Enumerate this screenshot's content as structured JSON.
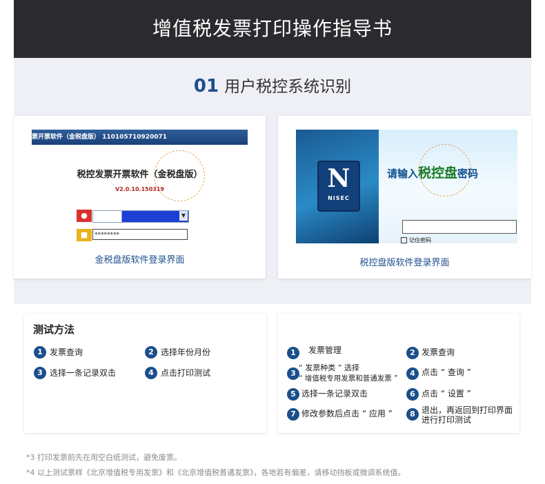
{
  "header": {
    "title": "增值税发票打印操作指导书"
  },
  "section": {
    "num": "01",
    "title": "用户税控系统识别"
  },
  "left_shot": {
    "window_title": "票开票软件（金税盘版） 110105710920071",
    "app_name": "税控发票开票软件（金税盘版）",
    "version": "V2.0.10.150319",
    "password_mask": "********",
    "caption": "金税盘版软件登录界面"
  },
  "right_shot": {
    "logo_text": "NISEC",
    "prompt_pre": "请输入",
    "prompt_big": "税控盘",
    "prompt_post": "密码",
    "remember": "记住密码",
    "caption": "税控盘版软件登录界面"
  },
  "test": {
    "title": "测试方法",
    "steps": [
      {
        "n": "1",
        "text": "发票查询"
      },
      {
        "n": "2",
        "text": "选择年份月份"
      },
      {
        "n": "3",
        "text": "选择一条记录双击"
      },
      {
        "n": "4",
        "text": "点击打印测试"
      }
    ]
  },
  "steps": [
    {
      "n": "1",
      "line1": "发票管理",
      "line2": ""
    },
    {
      "n": "2",
      "line1": "发票查询",
      "line2": ""
    },
    {
      "n": "3",
      "line1": "“ 发票种类 ” 选择",
      "line2": "“ 增值税专用发票和普通发票 ”"
    },
    {
      "n": "4",
      "line1": "点击 “ 查询 ”",
      "line2": ""
    },
    {
      "n": "5",
      "line1": "选择一条记录双击",
      "line2": ""
    },
    {
      "n": "6",
      "line1": "点击 “ 设置 ”",
      "line2": ""
    },
    {
      "n": "7",
      "line1": "修改参数后点击 “ 应用 ”",
      "line2": ""
    },
    {
      "n": "8",
      "line1": "退出，再返回到打印界面",
      "line2": "进行打印测试"
    }
  ],
  "notes": {
    "n1": "*3 打印发票前先在用空白纸测试，避免废票。",
    "n2": "*4 以上测试票样《北京增值税专用发票》和《北京增值税普通发票》，各地若有偏差，请移动挡板或微调系统值。"
  }
}
